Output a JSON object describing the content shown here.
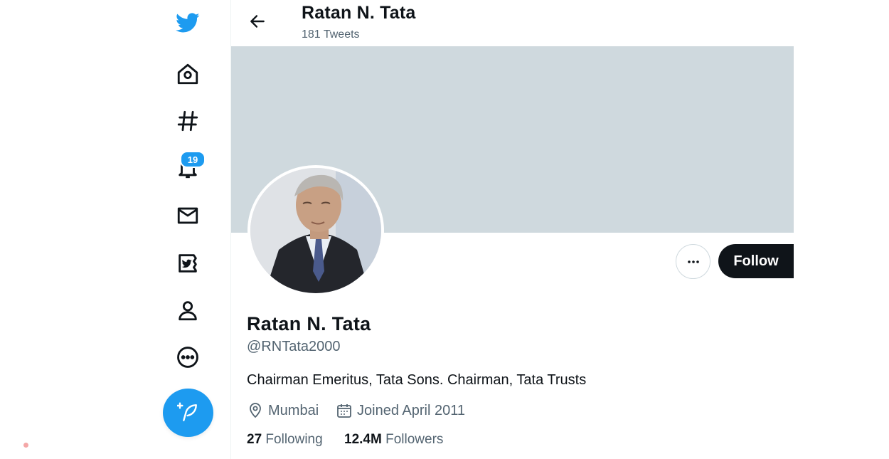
{
  "sidebar": {
    "items": [
      {
        "name": "twitter-logo-icon"
      },
      {
        "name": "home-icon"
      },
      {
        "name": "explore-hashtag-icon"
      },
      {
        "name": "notifications-bell-icon"
      },
      {
        "name": "messages-envelope-icon"
      },
      {
        "name": "twitter-blue-icon"
      },
      {
        "name": "profile-person-icon"
      },
      {
        "name": "more-circle-icon"
      }
    ],
    "notifications_badge": "19",
    "compose_icon": "feather-plus-icon",
    "accent_color": "#1d9bf0"
  },
  "header": {
    "name": "Ratan N. Tata",
    "tweet_count": "181 Tweets"
  },
  "profile": {
    "name": "Ratan N. Tata",
    "handle": "@RNTata2000",
    "bio": "Chairman Emeritus, Tata Sons. Chairman, Tata Trusts",
    "location": "Mumbai",
    "joined": "Joined April 2011",
    "following_count": "27",
    "following_label": "Following",
    "followers_count": "12.4M",
    "followers_label": "Followers",
    "follow_label": "Follow",
    "banner_color": "#cfd9de"
  }
}
